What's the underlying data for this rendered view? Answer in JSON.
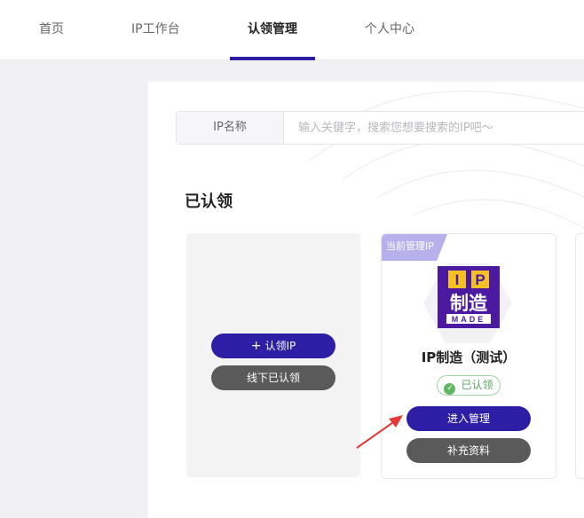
{
  "nav": {
    "tabs": [
      {
        "label": "首页"
      },
      {
        "label": "IP工作台"
      },
      {
        "label": "认领管理"
      },
      {
        "label": "个人中心"
      }
    ]
  },
  "search": {
    "label": "IP名称",
    "placeholder": "输入关键字，搜索您想要搜索的IP吧～"
  },
  "claimed_section": {
    "title": "已认领",
    "add_card": {
      "claim_button": "认领IP",
      "offline_button": "线下已认领"
    },
    "ip_card": {
      "tag": "当前管理IP",
      "logo_text": [
        "I",
        "P",
        "制造",
        "MADE"
      ],
      "name": "IP制造（测试）",
      "status": "已认领",
      "manage_button": "进入管理",
      "supplement_button": "补充资料"
    }
  },
  "colors": {
    "accent": "#2c1fa6",
    "gray_button": "#5a5a5a",
    "tag": "#b6b0ec",
    "logo_bg": "#4b1aa0",
    "logo_yellow": "#f5c021",
    "success": "#5fb764",
    "arrow": "#e53935"
  }
}
